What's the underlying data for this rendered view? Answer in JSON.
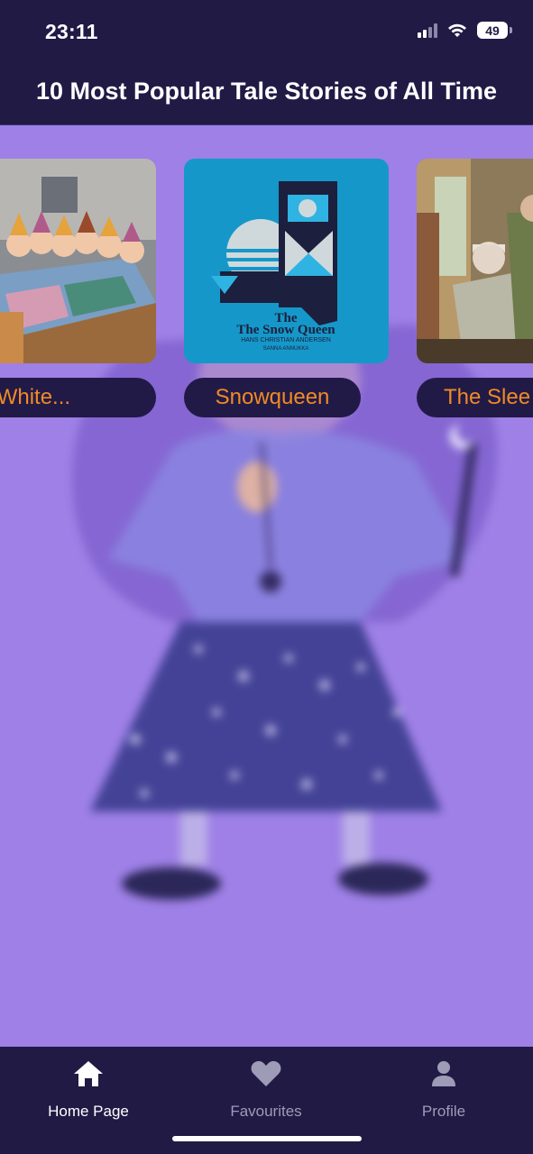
{
  "status_bar": {
    "time": "23:11",
    "battery": "49"
  },
  "header": {
    "title": "10 Most Popular Tale Stories of All Time"
  },
  "stories": [
    {
      "label": "now White...",
      "cover_icon": "snow-white-dwarfs-illustration"
    },
    {
      "label": "Snowqueen",
      "cover_icon": "snow-queen-book-cover"
    },
    {
      "label": "The Slee",
      "cover_icon": "sleeping-beauty-illustration"
    }
  ],
  "snow_queen_cover": {
    "title": "The Snow Queen",
    "author": "HANS CHRISTIAN ANDERSEN",
    "illustrator": "SANNA ANNUKKA"
  },
  "bottom_nav": {
    "items": [
      {
        "label": "Home Page",
        "icon": "home-icon",
        "active": true
      },
      {
        "label": "Favourites",
        "icon": "heart-icon",
        "active": false
      },
      {
        "label": "Profile",
        "icon": "person-icon",
        "active": false
      }
    ]
  },
  "colors": {
    "background": "#9e80e6",
    "bars": "#201a45",
    "label_text": "#f08a26",
    "active_nav": "#ffffff",
    "inactive_nav": "#9e9bb6"
  }
}
